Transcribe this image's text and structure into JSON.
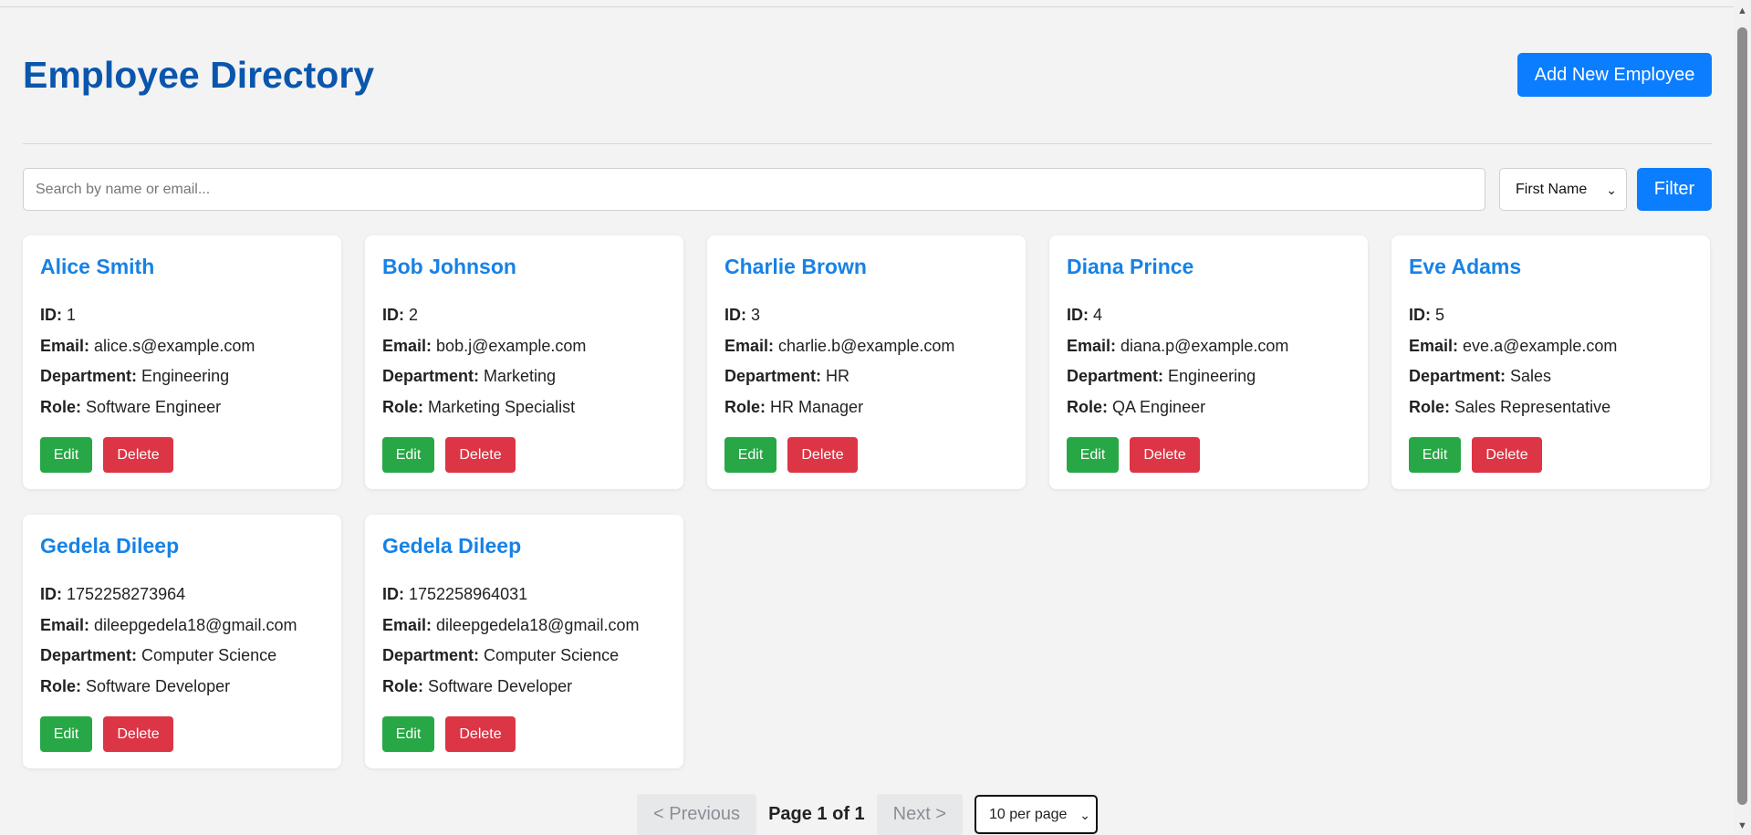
{
  "header": {
    "title": "Employee Directory",
    "add_button": "Add New Employee"
  },
  "search": {
    "placeholder": "Search by name or email...",
    "value": ""
  },
  "sort_select": {
    "selected": "First Name"
  },
  "filter_button": "Filter",
  "field_labels": {
    "id": "ID:",
    "email": "Email:",
    "department": "Department:",
    "role": "Role:"
  },
  "card_actions": {
    "edit": "Edit",
    "delete": "Delete"
  },
  "employees": [
    {
      "name": "Alice Smith",
      "id": "1",
      "email": "alice.s@example.com",
      "department": "Engineering",
      "role": "Software Engineer"
    },
    {
      "name": "Bob Johnson",
      "id": "2",
      "email": "bob.j@example.com",
      "department": "Marketing",
      "role": "Marketing Specialist"
    },
    {
      "name": "Charlie Brown",
      "id": "3",
      "email": "charlie.b@example.com",
      "department": "HR",
      "role": "HR Manager"
    },
    {
      "name": "Diana Prince",
      "id": "4",
      "email": "diana.p@example.com",
      "department": "Engineering",
      "role": "QA Engineer"
    },
    {
      "name": "Eve Adams",
      "id": "5",
      "email": "eve.a@example.com",
      "department": "Sales",
      "role": "Sales Representative"
    },
    {
      "name": "Gedela Dileep",
      "id": "1752258273964",
      "email": "dileepgedela18@gmail.com",
      "department": "Computer Science",
      "role": "Software Developer"
    },
    {
      "name": "Gedela Dileep",
      "id": "1752258964031",
      "email": "dileepgedela18@gmail.com",
      "department": "Computer Science",
      "role": "Software Developer"
    }
  ],
  "pagination": {
    "previous": "< Previous",
    "page_info": "Page 1 of 1",
    "next": "Next >",
    "per_page": "10 per page"
  }
}
